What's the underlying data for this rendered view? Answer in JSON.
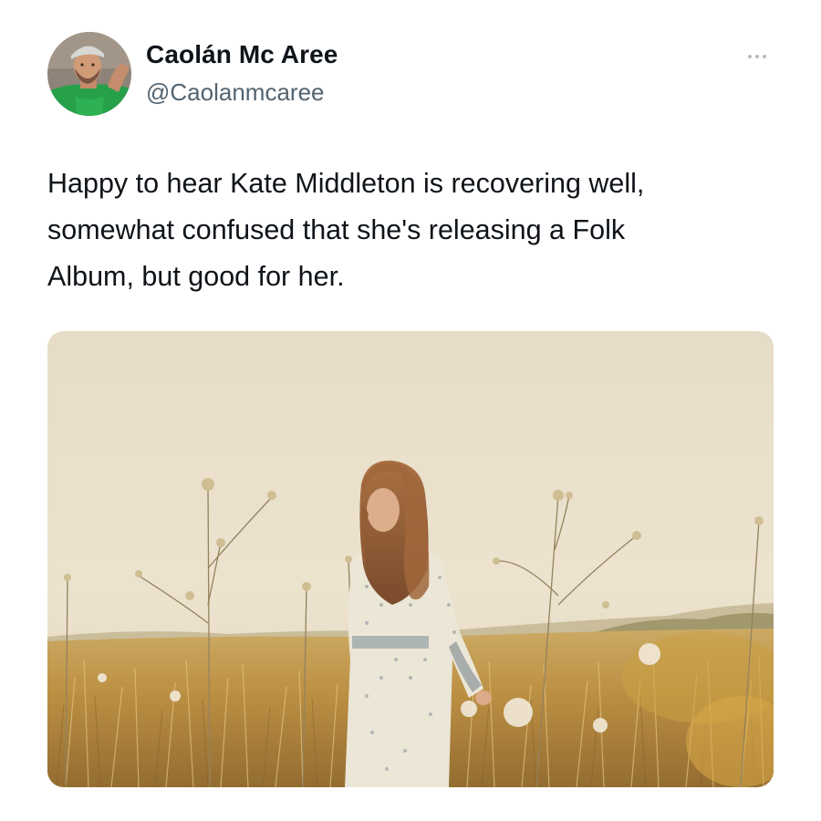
{
  "tweet": {
    "author": {
      "display_name": "Caolán Mc Aree",
      "handle": "@Caolanmcaree",
      "avatar_icon": "user-avatar"
    },
    "menu_icon": "more-options-icon",
    "text": "Happy to hear Kate Middleton is recovering well,\nsomewhat confused that she's releasing a Folk\nAlbum, but good for her.",
    "media": {
      "kind": "photo"
    }
  },
  "colors": {
    "text_primary": "#0f1419",
    "text_secondary": "#536471",
    "background": "#ffffff"
  }
}
